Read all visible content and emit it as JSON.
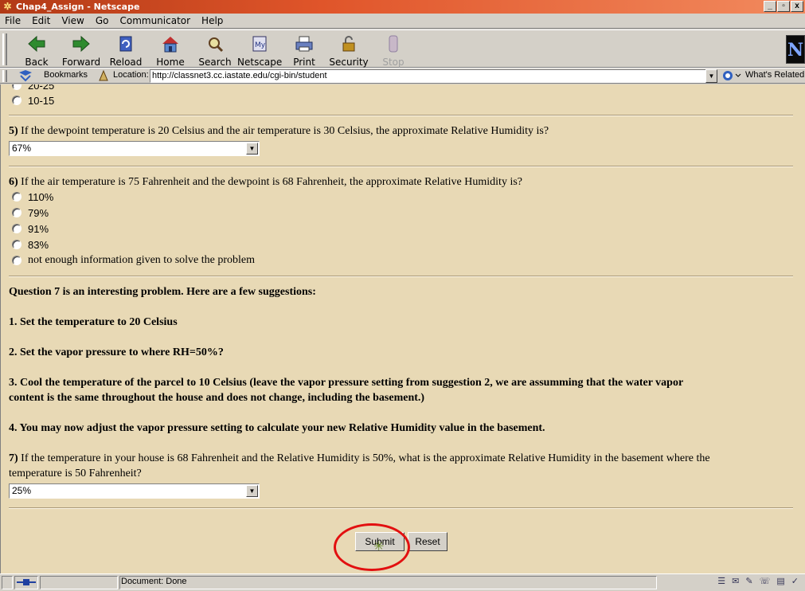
{
  "window": {
    "title": "Chap4_Assign - Netscape",
    "controls": [
      "_",
      "▫",
      "x"
    ]
  },
  "menu": [
    "File",
    "Edit",
    "View",
    "Go",
    "Communicator",
    "Help"
  ],
  "toolbar": {
    "buttons": [
      {
        "label": "Back",
        "icon": "back-arrow-icon"
      },
      {
        "label": "Forward",
        "icon": "forward-arrow-icon"
      },
      {
        "label": "Reload",
        "icon": "reload-icon"
      },
      {
        "label": "Home",
        "icon": "home-icon"
      },
      {
        "label": "Search",
        "icon": "search-icon"
      },
      {
        "label": "Netscape",
        "icon": "netscape-icon"
      },
      {
        "label": "Print",
        "icon": "print-icon"
      },
      {
        "label": "Security",
        "icon": "security-lock-icon"
      },
      {
        "label": "Stop",
        "icon": "stop-icon",
        "disabled": true
      }
    ],
    "brand_letter": "N"
  },
  "location": {
    "bookmarks_label": "Bookmarks",
    "location_label": "Location:",
    "url": "http://classnet3.cc.iastate.edu/cgi-bin/student",
    "related_label": "What's Related"
  },
  "page": {
    "prev_options": [
      "20-25",
      "10-15"
    ],
    "q5": {
      "number": "5)",
      "text": "If the dewpoint temperature is 20 Celsius and the air temperature is 30 Celsius, the approximate Relative Humidity is?",
      "selected": "67%"
    },
    "q6": {
      "number": "6)",
      "text": "If the air temperature is 75 Fahrenheit and the dewpoint is 68 Fahrenheit, the approximate Relative Humidity is?",
      "options": [
        "110%",
        "79%",
        "91%",
        "83%",
        "not enough information given to solve the problem"
      ]
    },
    "suggestions": {
      "intro": "Question 7 is an interesting problem. Here are a few suggestions:",
      "s1": "1. Set the temperature to 20 Celsius",
      "s2": "2. Set the vapor pressure to where RH=50%?",
      "s3_line1": "3. Cool the temperature of the parcel to 10 Celsius (leave the vapor pressure setting from suggestion 2, we are assumming that the water vapor",
      "s3_line2": "content is the same throughout the house and does not change, including the basement.)",
      "s4": "4. You may now adjust the vapor pressure setting to calculate your new Relative Humidity value in the basement."
    },
    "q7": {
      "number": "7)",
      "text_line1": "If the temperature in your house is 68 Fahrenheit and the Relative Humidity is 50%, what is the approximate Relative Humidity in the basement where the",
      "text_line2": "temperature is 50 Fahrenheit?",
      "selected": "25%"
    },
    "submit_label": "Submit",
    "reset_label": "Reset"
  },
  "status": {
    "text": "Document: Done"
  },
  "colors": {
    "page_bg": "#e8d9b5",
    "highlight_circle": "#e21010",
    "titlebar": "#e0552a"
  }
}
